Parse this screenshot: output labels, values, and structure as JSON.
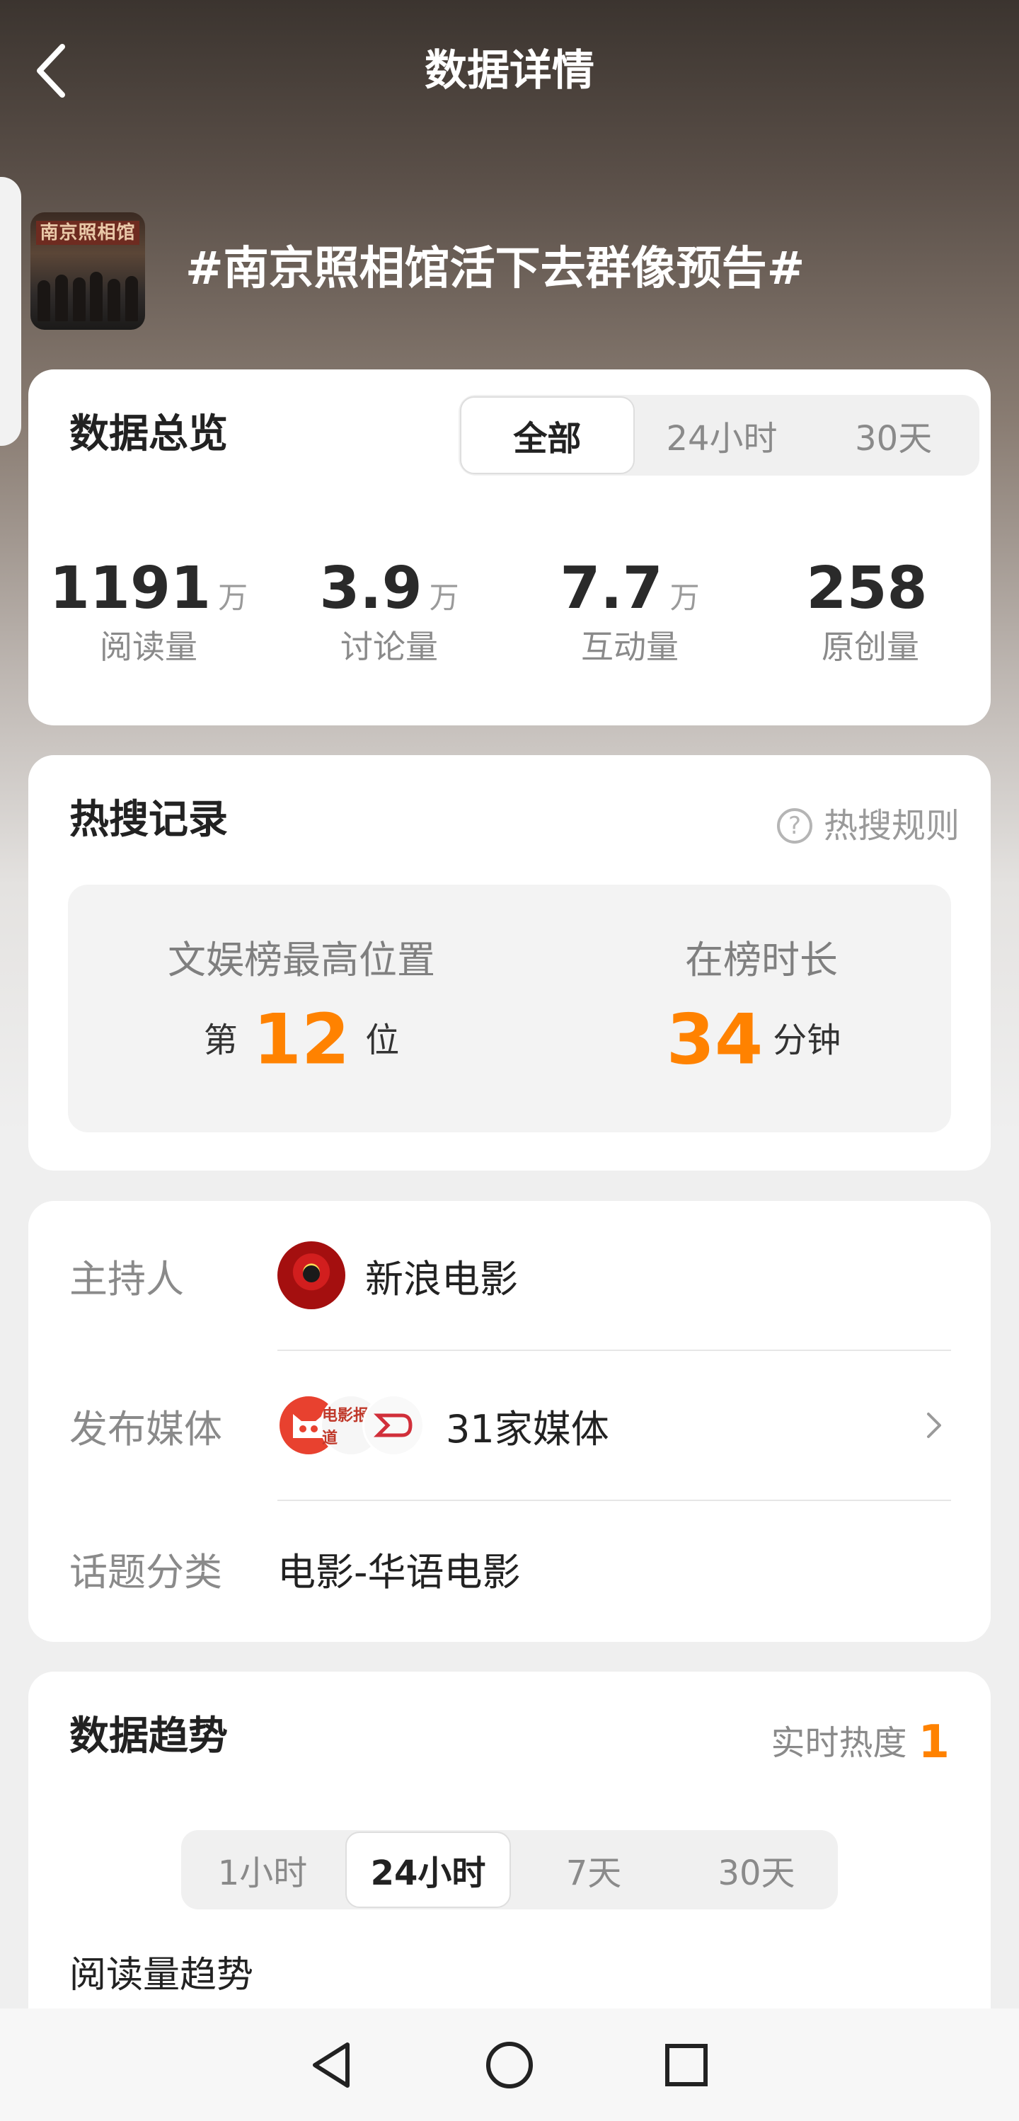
{
  "header": {
    "title": "数据详情",
    "back_icon": "chevron-left-icon"
  },
  "topic": {
    "title": "#南京照相馆活下去群像预告#",
    "thumbnail_sign": "南京照相馆"
  },
  "overview": {
    "title": "数据总览",
    "tabs": [
      "全部",
      "24小时",
      "30天"
    ],
    "active_tab": "全部",
    "stats": [
      {
        "value": "1191",
        "unit": "万",
        "label": "阅读量"
      },
      {
        "value": "3.9",
        "unit": "万",
        "label": "讨论量"
      },
      {
        "value": "7.7",
        "unit": "万",
        "label": "互动量"
      },
      {
        "value": "258",
        "unit": "",
        "label": "原创量"
      }
    ]
  },
  "hot_search": {
    "title": "热搜记录",
    "rules_label": "热搜规则",
    "help_glyph": "?",
    "best_position": {
      "label": "文娱榜最高位置",
      "prefix": "第",
      "value": "12",
      "suffix": "位"
    },
    "duration": {
      "label": "在榜时长",
      "value": "34",
      "suffix": "分钟"
    }
  },
  "info": {
    "host_label": "主持人",
    "host_name": "新浪电影",
    "media_label": "发布媒体",
    "media_count": "31家媒体",
    "media_avatar_texts": [
      "",
      "电影报道",
      ""
    ],
    "category_label": "话题分类",
    "category": "电影-华语电影"
  },
  "trend": {
    "title": "数据趋势",
    "realtime_label": "实时热度",
    "realtime_value": "1",
    "tabs": [
      "1小时",
      "24小时",
      "7天",
      "30天"
    ],
    "active_tab": "24小时",
    "subtitle": "阅读量趋势"
  },
  "system_nav": {
    "icons": [
      "back-triangle-icon",
      "home-circle-icon",
      "recents-square-icon"
    ]
  },
  "colors": {
    "accent": "#ff8200",
    "card": "#ffffff",
    "text_primary": "#222222",
    "text_secondary": "#8a8a8a"
  }
}
